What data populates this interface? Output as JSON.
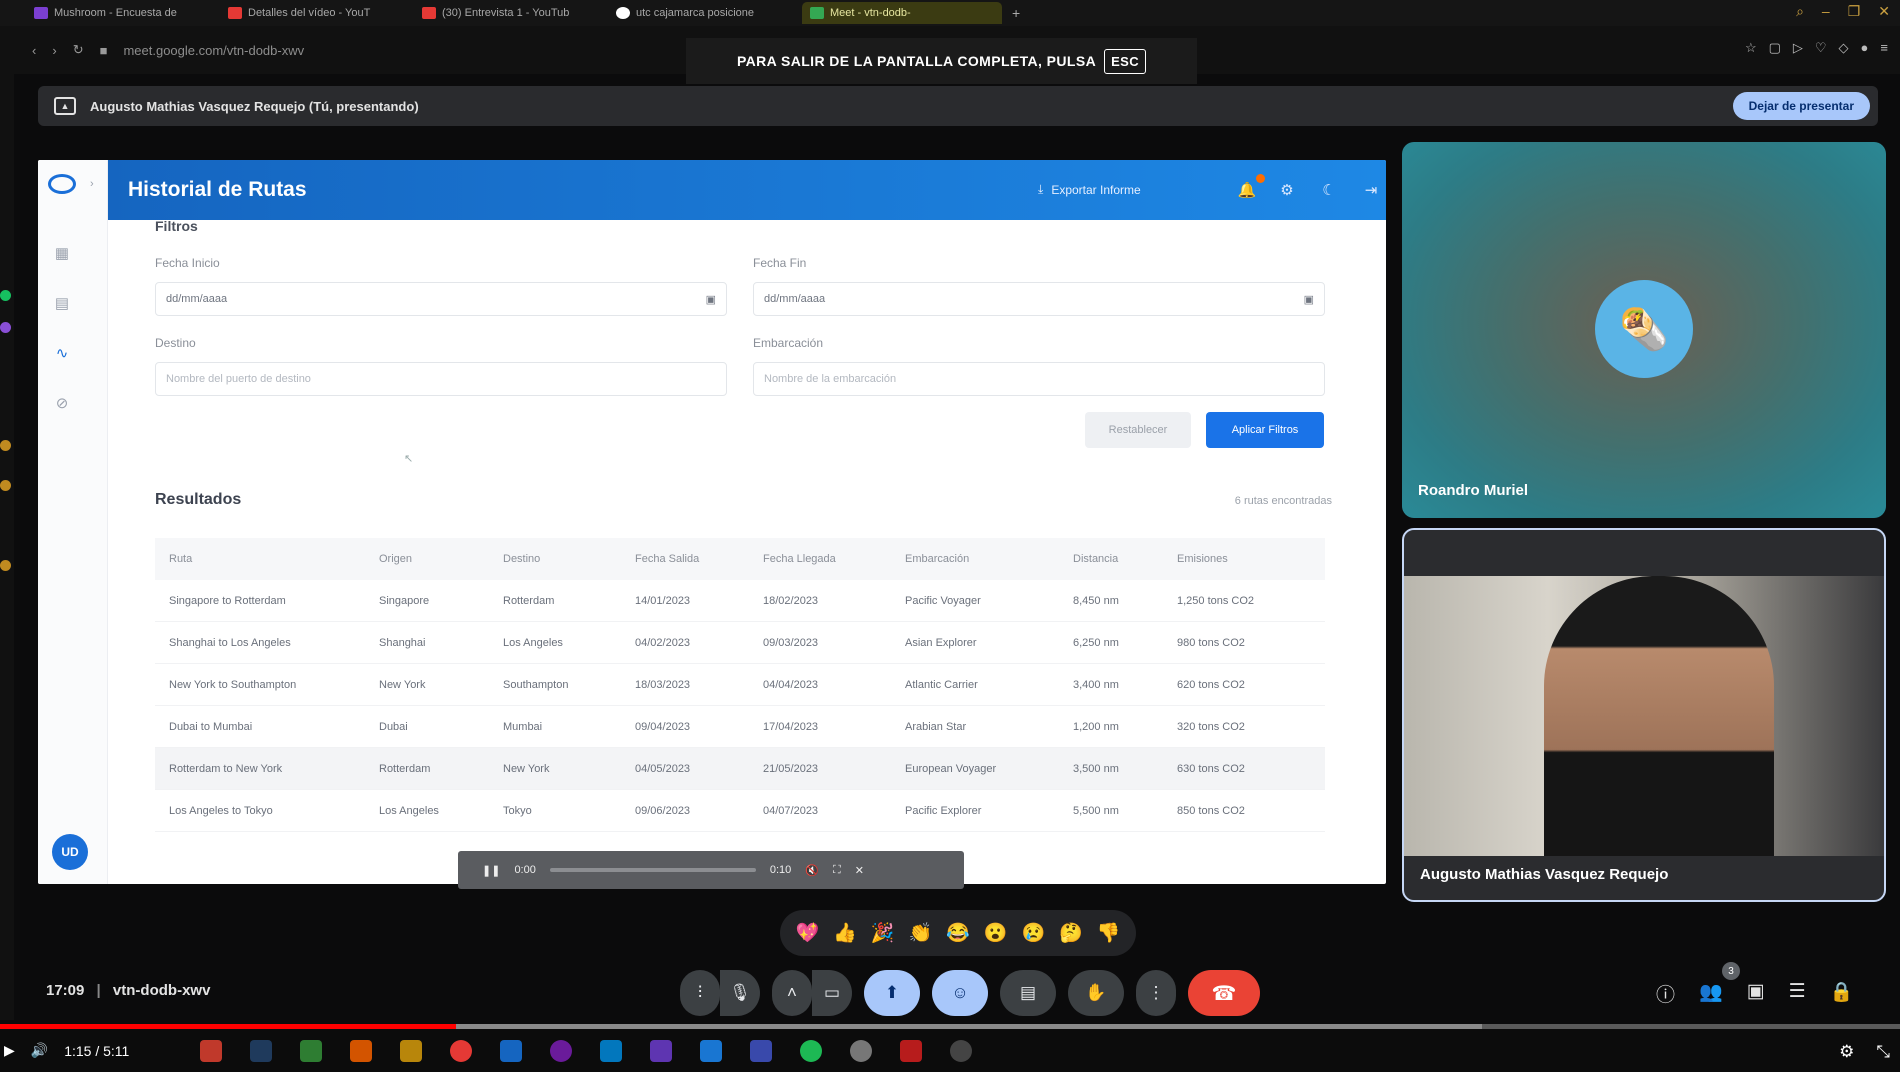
{
  "browser": {
    "tabs": [
      {
        "label": "Mushroom - Encuesta de",
        "color": "#7b3fd1"
      },
      {
        "label": "Detalles del vídeo - YouT",
        "color": "#e53935"
      },
      {
        "label": "(30) Entrevista 1 - YouTub",
        "color": "#e53935"
      },
      {
        "label": "utc cajamarca posicione",
        "color": "#ffffff"
      },
      {
        "label": "Meet - vtn-dodb-",
        "color": "#34a853",
        "active": true
      }
    ],
    "url": "meet.google.com/vtn-dodb-xwv",
    "fullscreen_notice": "PARA SALIR DE LA PANTALLA COMPLETA, PULSA",
    "fullscreen_key": "ESC"
  },
  "presenting": {
    "text": "Augusto Mathias Vasquez Requejo (Tú, presentando)",
    "stop_label": "Dejar de presentar"
  },
  "app": {
    "title": "Historial de Rutas",
    "export_label": "Exportar Informe",
    "avatar_initials": "UD",
    "filters": {
      "section_title": "Filtros",
      "start_label": "Fecha Inicio",
      "start_value": "dd/mm/aaaa",
      "end_label": "Fecha Fin",
      "end_value": "dd/mm/aaaa",
      "dest_label": "Destino",
      "dest_placeholder": "Nombre del puerto de destino",
      "vessel_label": "Embarcación",
      "vessel_placeholder": "Nombre de la embarcación",
      "reset_label": "Restablecer",
      "apply_label": "Aplicar Filtros"
    },
    "results": {
      "title": "Resultados",
      "count_text": "6 rutas encontradas",
      "columns": [
        "Ruta",
        "Origen",
        "Destino",
        "Fecha Salida",
        "Fecha Llegada",
        "Embarcación",
        "Distancia",
        "Emisiones"
      ],
      "rows": [
        [
          "Singapore to Rotterdam",
          "Singapore",
          "Rotterdam",
          "14/01/2023",
          "18/02/2023",
          "Pacific Voyager",
          "8,450 nm",
          "1,250 tons CO2"
        ],
        [
          "Shanghai to Los Angeles",
          "Shanghai",
          "Los Angeles",
          "04/02/2023",
          "09/03/2023",
          "Asian Explorer",
          "6,250 nm",
          "980 tons CO2"
        ],
        [
          "New York to Southampton",
          "New York",
          "Southampton",
          "18/03/2023",
          "04/04/2023",
          "Atlantic Carrier",
          "3,400 nm",
          "620 tons CO2"
        ],
        [
          "Dubai to Mumbai",
          "Dubai",
          "Mumbai",
          "09/04/2023",
          "17/04/2023",
          "Arabian Star",
          "1,200 nm",
          "320 tons CO2"
        ],
        [
          "Rotterdam to New York",
          "Rotterdam",
          "New York",
          "04/05/2023",
          "21/05/2023",
          "European Voyager",
          "3,500 nm",
          "630 tons CO2"
        ],
        [
          "Los Angeles to Tokyo",
          "Los Angeles",
          "Tokyo",
          "09/06/2023",
          "04/07/2023",
          "Pacific Explorer",
          "5,500 nm",
          "850 tons CO2"
        ]
      ]
    }
  },
  "video_overlay": {
    "current": "0:00",
    "total": "0:10",
    "progress": 0.0
  },
  "participants": [
    {
      "name": "Roandro Muriel"
    },
    {
      "name": "Augusto Mathias Vasquez Requejo"
    }
  ],
  "reactions": [
    "💖",
    "👍",
    "🎉",
    "👏",
    "😂",
    "😮",
    "😢",
    "🤔",
    "👎"
  ],
  "meeting": {
    "time": "17:09",
    "code": "vtn-dodb-xwv",
    "people_count": "3"
  },
  "youtube": {
    "time": "1:15 / 5:11",
    "played_fraction": 0.24,
    "buffered_fraction": 0.78
  }
}
